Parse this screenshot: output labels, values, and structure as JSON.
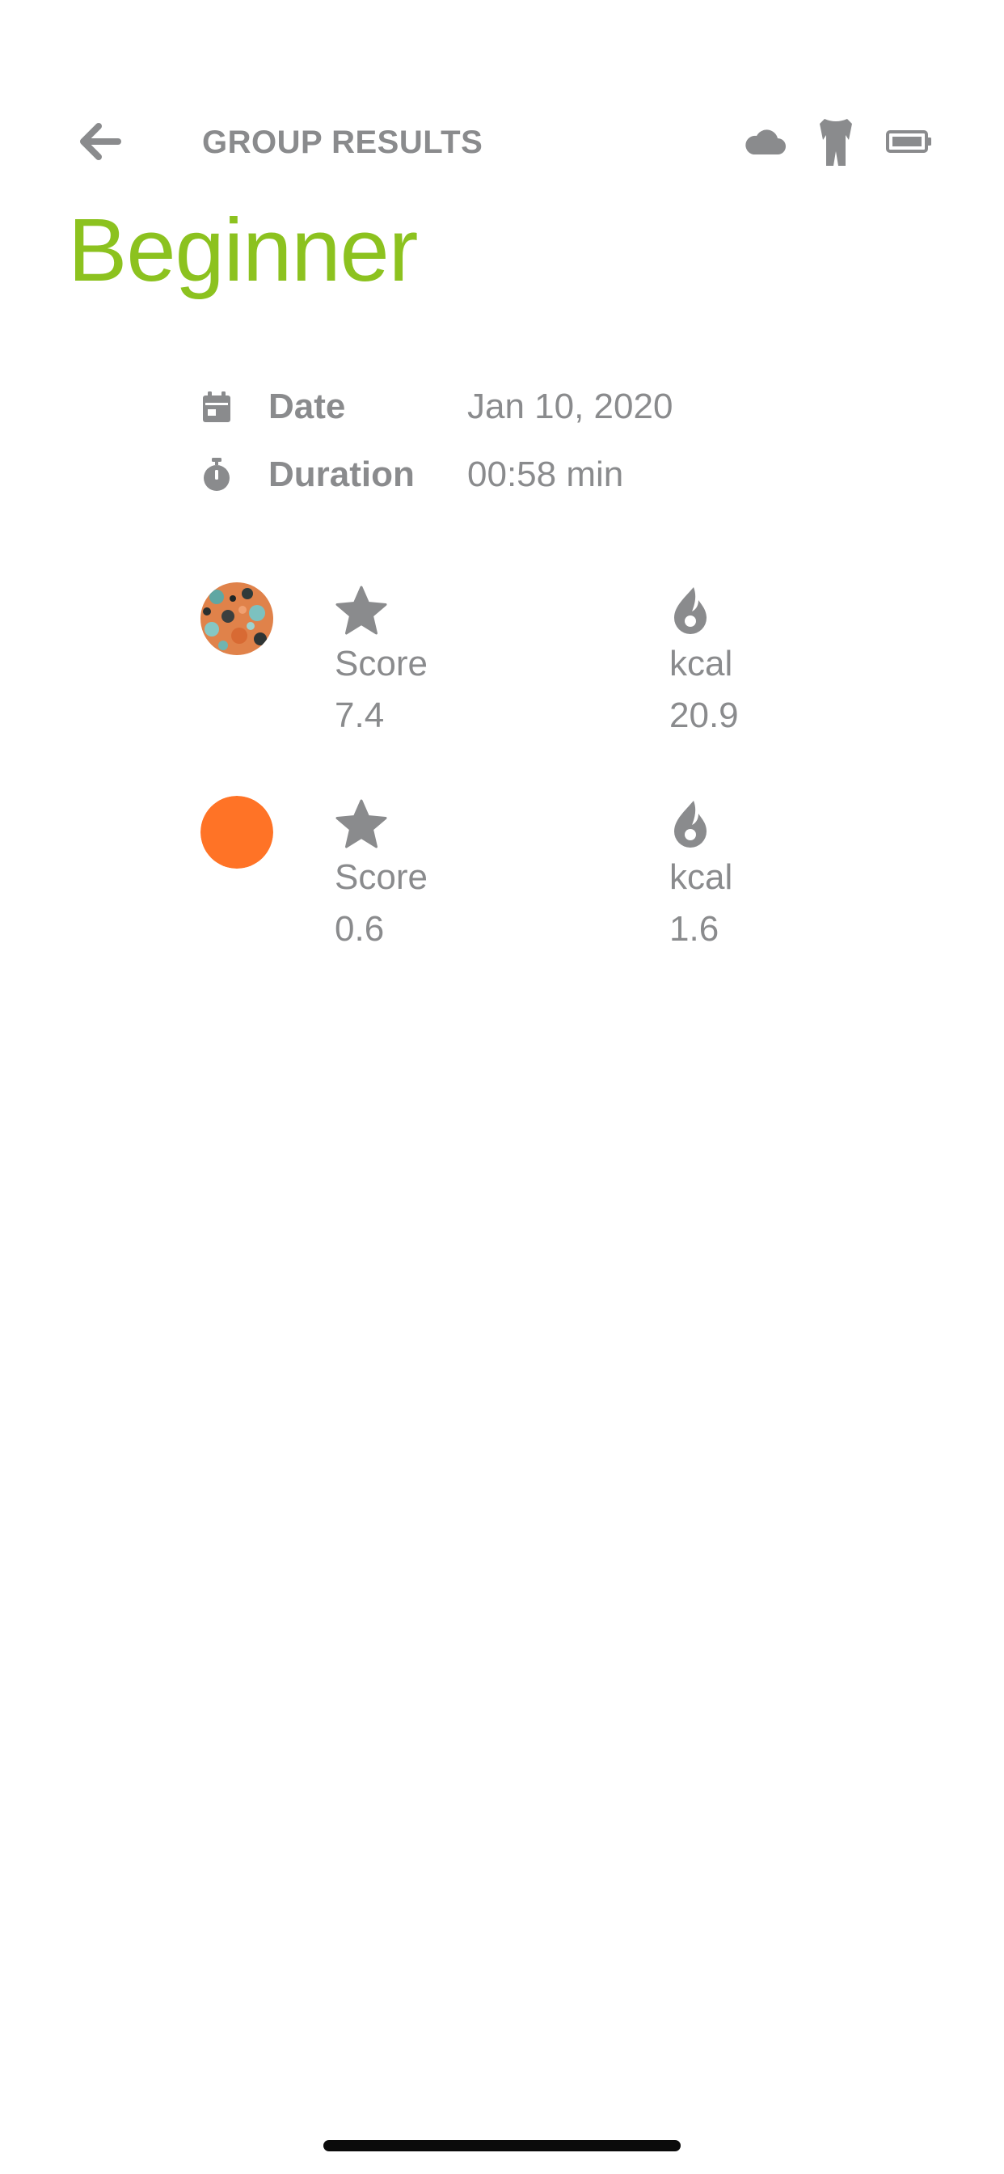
{
  "colors": {
    "accent": "#8cc21f",
    "text": "#8a8b8d",
    "icon": "#8a8b8d",
    "avatar_orange": "#ff7326"
  },
  "header": {
    "title": "GROUP RESULTS",
    "back_icon": "arrow-left-icon",
    "status_icons": [
      "cloud-icon",
      "bodysuit-icon",
      "battery-icon"
    ]
  },
  "page": {
    "title": "Beginner"
  },
  "info": {
    "date": {
      "label": "Date",
      "value": "Jan 10, 2020",
      "icon": "calendar-icon"
    },
    "duration": {
      "label": "Duration",
      "value": "00:58 min",
      "icon": "stopwatch-icon"
    }
  },
  "results": [
    {
      "avatar": "patterned-avatar",
      "score": {
        "label": "Score",
        "value": "7.4",
        "icon": "star-icon"
      },
      "kcal": {
        "label": "kcal",
        "value": "20.9",
        "icon": "flame-icon"
      }
    },
    {
      "avatar": "orange-avatar",
      "score": {
        "label": "Score",
        "value": "0.6",
        "icon": "star-icon"
      },
      "kcal": {
        "label": "kcal",
        "value": "1.6",
        "icon": "flame-icon"
      }
    }
  ]
}
